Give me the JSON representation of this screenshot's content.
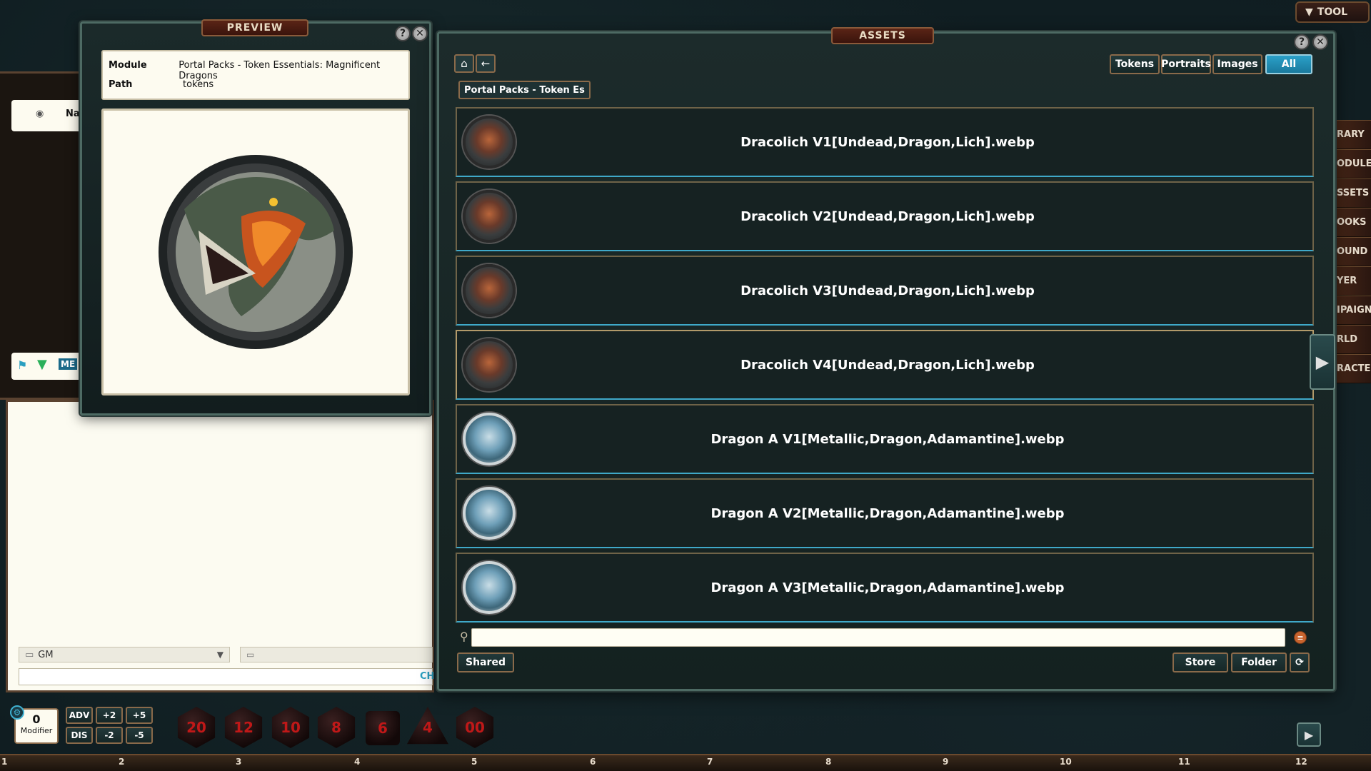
{
  "tool_tab": {
    "label": "TOOL",
    "caret": "▼"
  },
  "sidebar": {
    "items": [
      {
        "label": "RARY"
      },
      {
        "label": "ODULES"
      },
      {
        "label": "SSETS"
      },
      {
        "label": "OOKS"
      },
      {
        "label": "OUND SE"
      },
      {
        "label": "YER"
      },
      {
        "label": "IPAIGN"
      },
      {
        "label": "RLD"
      },
      {
        "label": "RACTER"
      }
    ]
  },
  "left_panel": {
    "card_label": "Na",
    "tag": "ME"
  },
  "preview": {
    "title": "PREVIEW",
    "help_glyph": "?",
    "close_glyph": "✕",
    "module_key": "Module",
    "module_value": "Portal Packs - Token Essentials: Magnificent Dragons",
    "path_key": "Path",
    "path_value": "tokens"
  },
  "assets": {
    "title": "ASSETS",
    "help_glyph": "?",
    "close_glyph": "✕",
    "home_glyph": "⌂",
    "back_glyph": "←",
    "filters": [
      {
        "label": "Tokens",
        "active": false
      },
      {
        "label": "Portraits",
        "active": false
      },
      {
        "label": "Images",
        "active": false
      },
      {
        "label": "All",
        "active": true
      }
    ],
    "breadcrumb": "Portal Packs - Token Es",
    "items": [
      {
        "name": "Dracolich V1[Undead,Dragon,Lich].webp",
        "tone": "dark"
      },
      {
        "name": "Dracolich V2[Undead,Dragon,Lich].webp",
        "tone": "dark"
      },
      {
        "name": "Dracolich V3[Undead,Dragon,Lich].webp",
        "tone": "dark"
      },
      {
        "name": "Dracolich V4[Undead,Dragon,Lich].webp",
        "tone": "dark"
      },
      {
        "name": "Dragon A V1[Metallic,Dragon,Adamantine].webp",
        "tone": "light"
      },
      {
        "name": "Dragon A V2[Metallic,Dragon,Adamantine].webp",
        "tone": "light"
      },
      {
        "name": "Dragon A V3[Metallic,Dragon,Adamantine].webp",
        "tone": "light"
      }
    ],
    "search_value": "",
    "shared_label": "Shared",
    "store_label": "Store",
    "folder_label": "Folder",
    "refresh_glyph": "⟳",
    "next_glyph": "▶"
  },
  "chat": {
    "identity": "GM",
    "send_label": "CH"
  },
  "dice_bar": {
    "modifier_value": "0",
    "modifier_label": "Modifier",
    "adv": "ADV",
    "dis": "DIS",
    "plus2": "+2",
    "plus5": "+5",
    "minus2": "-2",
    "minus5": "-5",
    "dice": [
      "20",
      "12",
      "10",
      "8",
      "6",
      "4",
      "00"
    ]
  },
  "ruler": {
    "ticks": [
      "1",
      "2",
      "3",
      "4",
      "5",
      "6",
      "7",
      "8",
      "9",
      "10",
      "11",
      "12"
    ]
  },
  "colors": {
    "accent": "#2aa0c8",
    "frame": "#4d6a63",
    "title_bar": "#5a2416"
  }
}
